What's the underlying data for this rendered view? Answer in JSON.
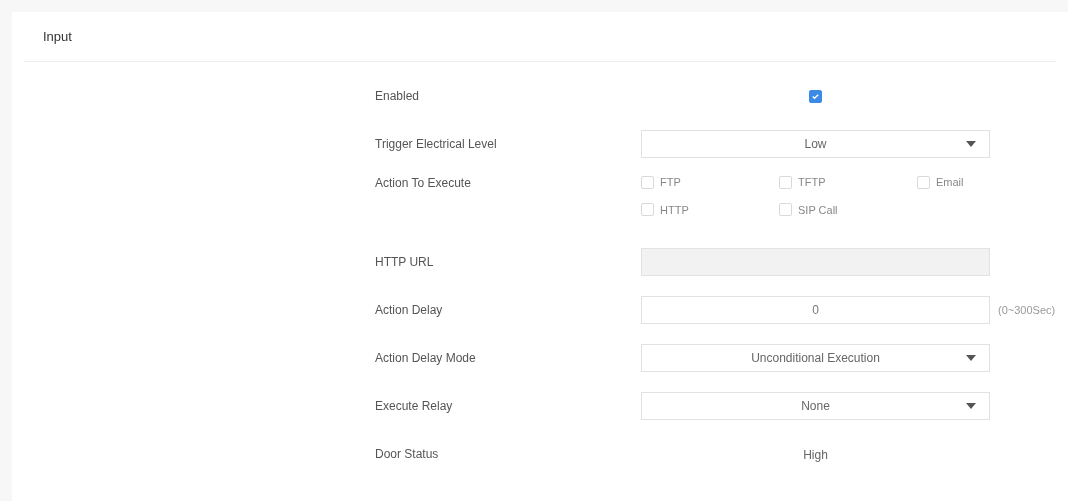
{
  "title": "Input",
  "rows": [
    {
      "kind": "checkbox",
      "label": "Enabled",
      "checked": true
    },
    {
      "kind": "select",
      "label": "Trigger Electrical Level",
      "value": "Low"
    },
    {
      "kind": "checkgroup",
      "label": "Action To Execute",
      "options": [
        {
          "label": "FTP",
          "checked": false
        },
        {
          "label": "TFTP",
          "checked": false
        },
        {
          "label": "Email",
          "checked": false
        },
        {
          "label": "HTTP",
          "checked": false
        },
        {
          "label": "SIP Call",
          "checked": false
        }
      ]
    },
    {
      "kind": "input",
      "label": "HTTP URL",
      "disabled": true
    },
    {
      "kind": "input",
      "label": "Action Delay",
      "value": "0",
      "disabled": false,
      "suffix": "(0~300Sec)"
    },
    {
      "kind": "select",
      "label": "Action Delay Mode",
      "value": "Unconditional Execution"
    },
    {
      "kind": "select",
      "label": "Execute Relay",
      "value": "None"
    },
    {
      "kind": "text",
      "label": "Door Status",
      "value": "High"
    }
  ]
}
